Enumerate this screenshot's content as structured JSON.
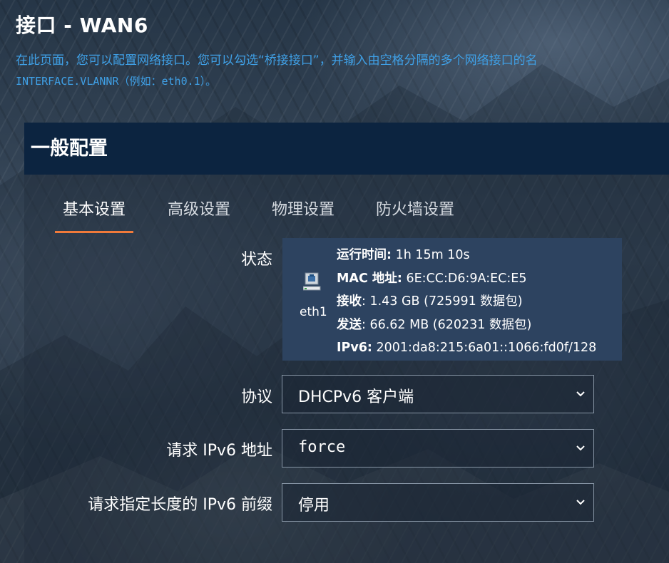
{
  "page": {
    "title": "接口 - WAN6",
    "description_line1": "在此页面，您可以配置网络接口。您可以勾选“桥接接口”，并输入由空格分隔的多个网络接口的名",
    "description_line2": "INTERFACE.VLANNR（例如：eth0.1）。"
  },
  "section": {
    "title": "一般配置",
    "tabs": [
      {
        "label": "基本设置",
        "active": true
      },
      {
        "label": "高级设置",
        "active": false
      },
      {
        "label": "物理设置",
        "active": false
      },
      {
        "label": "防火墙设置",
        "active": false
      }
    ]
  },
  "status": {
    "label": "状态",
    "device": "eth1",
    "icon": "ethernet-port-icon",
    "uptime_label": "运行时间:",
    "uptime_value": "1h 15m 10s",
    "mac_label": "MAC 地址:",
    "mac_value": "6E:CC:D6:9A:EC:E5",
    "rx_label": "接收",
    "rx_value": ": 1.43 GB (725991 数据包)",
    "tx_label": "发送",
    "tx_value": ": 66.62 MB (620231 数据包)",
    "ipv6_label": "IPv6:",
    "ipv6_value": "2001:da8:215:6a01::1066:fd0f/128"
  },
  "fields": {
    "protocol": {
      "label": "协议",
      "value": "DHCPv6  客户端"
    },
    "request_ipv6": {
      "label": "请求 IPv6 地址",
      "value": "force"
    },
    "prefix_length": {
      "label": "请求指定长度的 IPv6 前缀",
      "value": "停用"
    }
  },
  "colors": {
    "accent_tab": "#f07a3a",
    "header_bg": "#0c2440",
    "status_bg": "#2d4360",
    "link_text": "#3fa0e6"
  }
}
